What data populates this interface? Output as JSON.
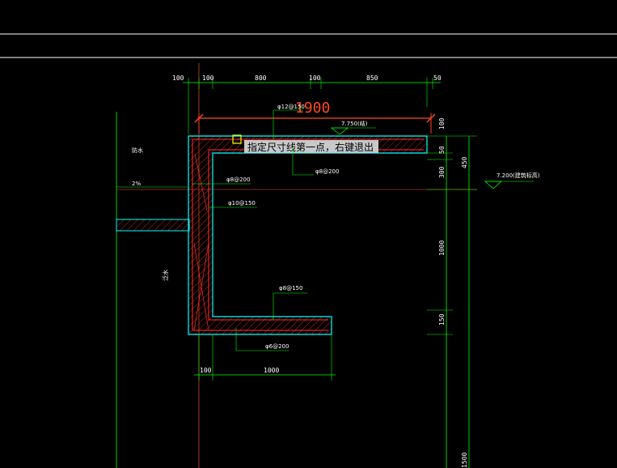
{
  "drawing": {
    "top_dimensions": {
      "seg1": "100",
      "seg2": "100",
      "seg3": "800",
      "seg4": "100",
      "seg5": "850",
      "seg6": "50"
    },
    "temporary_dimension": "1900",
    "rebar_top_slab": "φ12@150",
    "elevation_top": "7.750(结)",
    "elevation_right": "7.200(建筑标高)",
    "right_dimensions": {
      "top_seg": "100",
      "seg_50": "50",
      "seg_300": "300",
      "total_450": "450",
      "seg_1000": "1000",
      "seg_150": "150",
      "lower_1500": "1500"
    },
    "rebar_slab_dist": "φ8@200",
    "rebar_wall_dist": "φ8@200",
    "rebar_wall_main": "φ10@150",
    "rebar_bottom_slab": "φ8@150",
    "rebar_bottom_dist": "φ6@200",
    "bottom_dimensions": {
      "seg1": "100",
      "seg2": "1000"
    },
    "slope": "2%",
    "left_note_upper": "防水",
    "left_note_wall": "泛水"
  },
  "command_tooltip": "指定尺寸线第一点，右键退出",
  "colors": {
    "background": "#000000",
    "dimension_line": "#00ff00",
    "concrete_outline": "#00ffff",
    "hatch": "#ff2020",
    "temporary_dimension": "#ff4a1c",
    "cursor_box": "#ffff00",
    "tooltip_bg": "#c8c8c8"
  }
}
